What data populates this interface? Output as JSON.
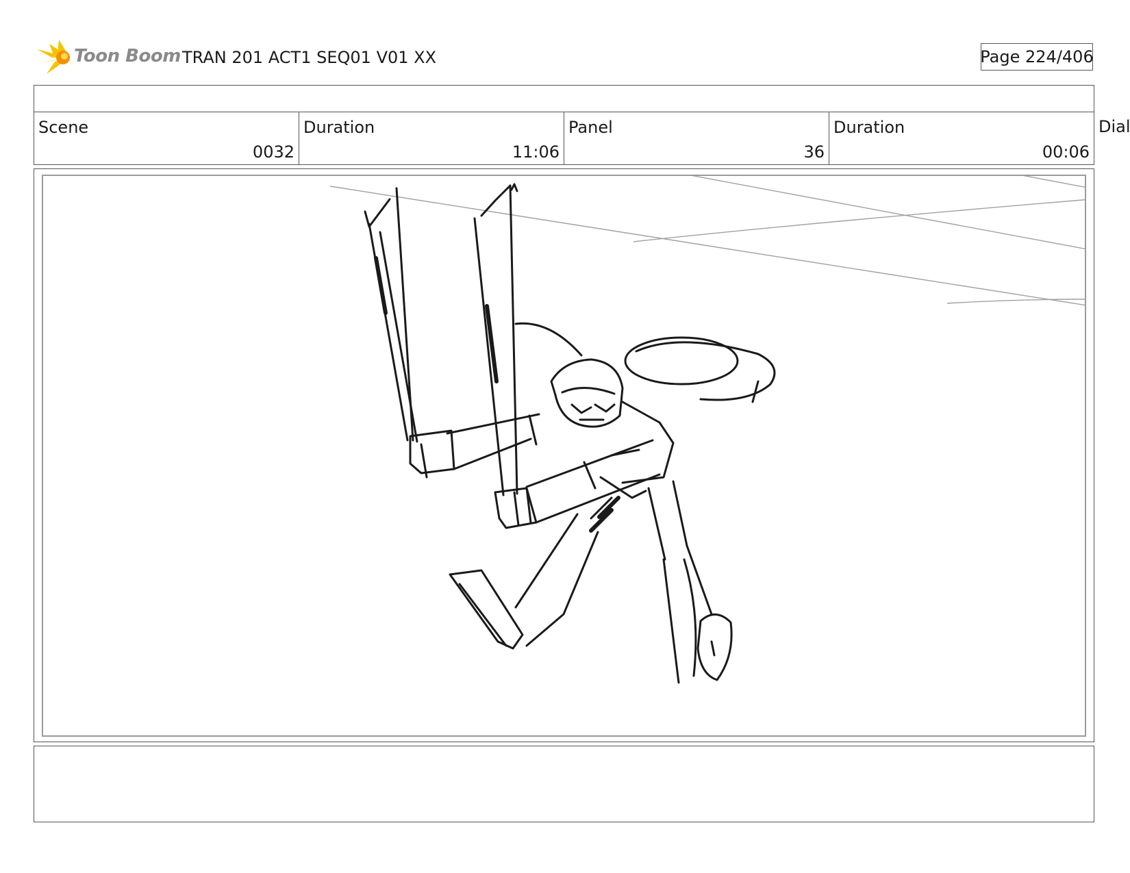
{
  "header": {
    "logo_text": "Toon Boom",
    "document_title": "TRAN 201 ACT1 SEQ01 V01 XX",
    "page_indicator": "Page 224/406"
  },
  "info_row": {
    "scene_label": "Scene",
    "scene_value": "0032",
    "scene_duration_label": "Duration",
    "scene_duration_value": "11:06",
    "panel_label": "Panel",
    "panel_value": "36",
    "panel_duration_label": "Duration",
    "panel_duration_value": "00:06",
    "dialog_label": "Dialo"
  },
  "colors": {
    "logo_yellow": "#f5c400",
    "logo_orange": "#f29100",
    "logo_text": "#8a8a8a",
    "frame_border": "#555555",
    "panel_border": "#9a9a9a",
    "sketch_line": "#1a1a1a",
    "guide_line": "#a0a0a0"
  },
  "panel": {
    "content": "rough storyboard sketch"
  }
}
